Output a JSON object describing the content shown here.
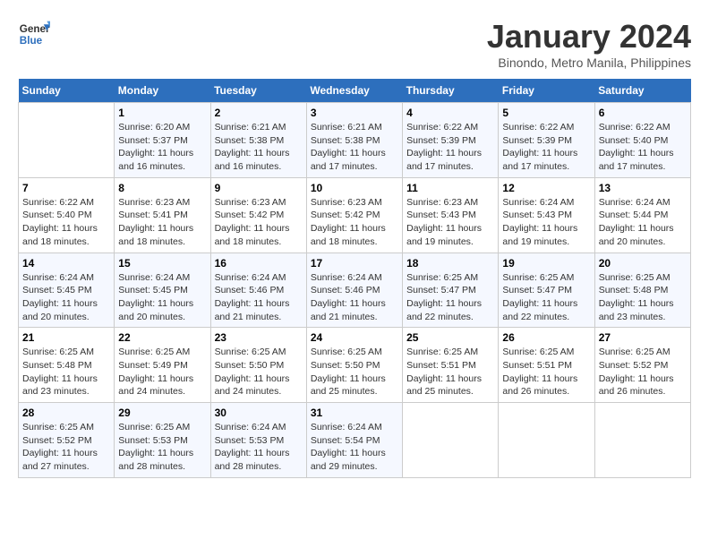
{
  "header": {
    "logo_line1": "General",
    "logo_line2": "Blue",
    "month_title": "January 2024",
    "subtitle": "Binondo, Metro Manila, Philippines"
  },
  "days_of_week": [
    "Sunday",
    "Monday",
    "Tuesday",
    "Wednesday",
    "Thursday",
    "Friday",
    "Saturday"
  ],
  "weeks": [
    [
      {
        "day": "",
        "info": ""
      },
      {
        "day": "1",
        "info": "Sunrise: 6:20 AM\nSunset: 5:37 PM\nDaylight: 11 hours\nand 16 minutes."
      },
      {
        "day": "2",
        "info": "Sunrise: 6:21 AM\nSunset: 5:38 PM\nDaylight: 11 hours\nand 16 minutes."
      },
      {
        "day": "3",
        "info": "Sunrise: 6:21 AM\nSunset: 5:38 PM\nDaylight: 11 hours\nand 17 minutes."
      },
      {
        "day": "4",
        "info": "Sunrise: 6:22 AM\nSunset: 5:39 PM\nDaylight: 11 hours\nand 17 minutes."
      },
      {
        "day": "5",
        "info": "Sunrise: 6:22 AM\nSunset: 5:39 PM\nDaylight: 11 hours\nand 17 minutes."
      },
      {
        "day": "6",
        "info": "Sunrise: 6:22 AM\nSunset: 5:40 PM\nDaylight: 11 hours\nand 17 minutes."
      }
    ],
    [
      {
        "day": "7",
        "info": "Sunrise: 6:22 AM\nSunset: 5:40 PM\nDaylight: 11 hours\nand 18 minutes."
      },
      {
        "day": "8",
        "info": "Sunrise: 6:23 AM\nSunset: 5:41 PM\nDaylight: 11 hours\nand 18 minutes."
      },
      {
        "day": "9",
        "info": "Sunrise: 6:23 AM\nSunset: 5:42 PM\nDaylight: 11 hours\nand 18 minutes."
      },
      {
        "day": "10",
        "info": "Sunrise: 6:23 AM\nSunset: 5:42 PM\nDaylight: 11 hours\nand 18 minutes."
      },
      {
        "day": "11",
        "info": "Sunrise: 6:23 AM\nSunset: 5:43 PM\nDaylight: 11 hours\nand 19 minutes."
      },
      {
        "day": "12",
        "info": "Sunrise: 6:24 AM\nSunset: 5:43 PM\nDaylight: 11 hours\nand 19 minutes."
      },
      {
        "day": "13",
        "info": "Sunrise: 6:24 AM\nSunset: 5:44 PM\nDaylight: 11 hours\nand 20 minutes."
      }
    ],
    [
      {
        "day": "14",
        "info": "Sunrise: 6:24 AM\nSunset: 5:45 PM\nDaylight: 11 hours\nand 20 minutes."
      },
      {
        "day": "15",
        "info": "Sunrise: 6:24 AM\nSunset: 5:45 PM\nDaylight: 11 hours\nand 20 minutes."
      },
      {
        "day": "16",
        "info": "Sunrise: 6:24 AM\nSunset: 5:46 PM\nDaylight: 11 hours\nand 21 minutes."
      },
      {
        "day": "17",
        "info": "Sunrise: 6:24 AM\nSunset: 5:46 PM\nDaylight: 11 hours\nand 21 minutes."
      },
      {
        "day": "18",
        "info": "Sunrise: 6:25 AM\nSunset: 5:47 PM\nDaylight: 11 hours\nand 22 minutes."
      },
      {
        "day": "19",
        "info": "Sunrise: 6:25 AM\nSunset: 5:47 PM\nDaylight: 11 hours\nand 22 minutes."
      },
      {
        "day": "20",
        "info": "Sunrise: 6:25 AM\nSunset: 5:48 PM\nDaylight: 11 hours\nand 23 minutes."
      }
    ],
    [
      {
        "day": "21",
        "info": "Sunrise: 6:25 AM\nSunset: 5:48 PM\nDaylight: 11 hours\nand 23 minutes."
      },
      {
        "day": "22",
        "info": "Sunrise: 6:25 AM\nSunset: 5:49 PM\nDaylight: 11 hours\nand 24 minutes."
      },
      {
        "day": "23",
        "info": "Sunrise: 6:25 AM\nSunset: 5:50 PM\nDaylight: 11 hours\nand 24 minutes."
      },
      {
        "day": "24",
        "info": "Sunrise: 6:25 AM\nSunset: 5:50 PM\nDaylight: 11 hours\nand 25 minutes."
      },
      {
        "day": "25",
        "info": "Sunrise: 6:25 AM\nSunset: 5:51 PM\nDaylight: 11 hours\nand 25 minutes."
      },
      {
        "day": "26",
        "info": "Sunrise: 6:25 AM\nSunset: 5:51 PM\nDaylight: 11 hours\nand 26 minutes."
      },
      {
        "day": "27",
        "info": "Sunrise: 6:25 AM\nSunset: 5:52 PM\nDaylight: 11 hours\nand 26 minutes."
      }
    ],
    [
      {
        "day": "28",
        "info": "Sunrise: 6:25 AM\nSunset: 5:52 PM\nDaylight: 11 hours\nand 27 minutes."
      },
      {
        "day": "29",
        "info": "Sunrise: 6:25 AM\nSunset: 5:53 PM\nDaylight: 11 hours\nand 28 minutes."
      },
      {
        "day": "30",
        "info": "Sunrise: 6:24 AM\nSunset: 5:53 PM\nDaylight: 11 hours\nand 28 minutes."
      },
      {
        "day": "31",
        "info": "Sunrise: 6:24 AM\nSunset: 5:54 PM\nDaylight: 11 hours\nand 29 minutes."
      },
      {
        "day": "",
        "info": ""
      },
      {
        "day": "",
        "info": ""
      },
      {
        "day": "",
        "info": ""
      }
    ]
  ]
}
